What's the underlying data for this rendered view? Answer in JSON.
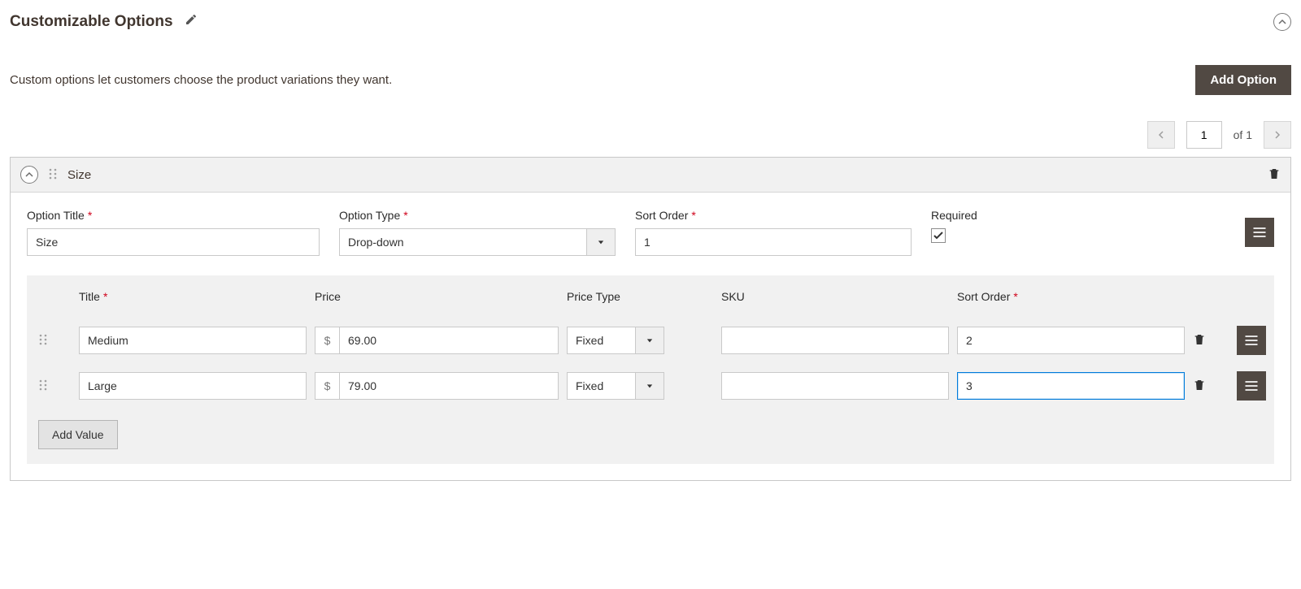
{
  "header": {
    "title": "Customizable Options"
  },
  "description": "Custom options let customers choose the product variations they want.",
  "buttons": {
    "add_option": "Add Option",
    "add_value": "Add Value"
  },
  "pagination": {
    "current": "1",
    "total_label": "of 1"
  },
  "labels": {
    "option_title": "Option Title",
    "option_type": "Option Type",
    "sort_order": "Sort Order",
    "required": "Required",
    "title": "Title",
    "price": "Price",
    "price_type": "Price Type",
    "sku": "SKU"
  },
  "option": {
    "name": "Size",
    "title_value": "Size",
    "type_value": "Drop-down",
    "sort_order_value": "1",
    "required_checked": true
  },
  "currency": "$",
  "values": [
    {
      "title": "Medium",
      "price": "69.00",
      "price_type": "Fixed",
      "sku": "",
      "sort_order": "2",
      "focused": false
    },
    {
      "title": "Large",
      "price": "79.00",
      "price_type": "Fixed",
      "sku": "",
      "sort_order": "3",
      "focused": true
    }
  ]
}
